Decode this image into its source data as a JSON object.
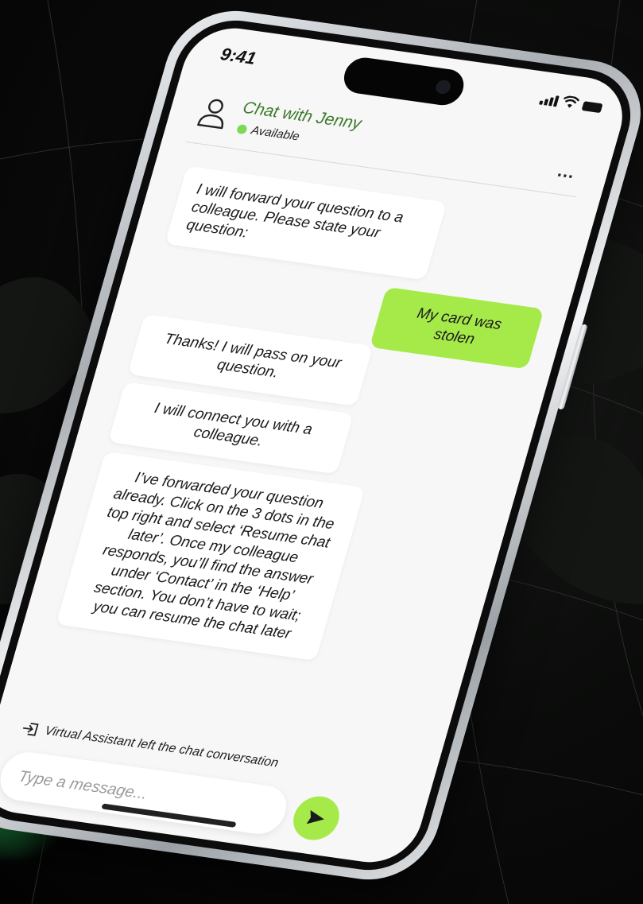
{
  "status_bar": {
    "time": "9:41"
  },
  "header": {
    "title": "Chat with Jenny",
    "status": "Available",
    "status_color": "#7ed957",
    "avatar_icon": "user-outline-icon",
    "more_label": "..."
  },
  "messages": [
    {
      "from": "bot",
      "text": "I will forward your question to a colleague. Please state your question:"
    },
    {
      "from": "user",
      "text": "My card was stolen"
    },
    {
      "from": "bot",
      "text": "Thanks! I will pass on your question."
    },
    {
      "from": "bot",
      "text": "I will connect you with a colleague."
    },
    {
      "from": "bot",
      "text": "I’ve forwarded your question already. Click on the 3 dots in the top right and select ‘Resume chat later’. Once my colleague responds, you’ll find the answer under ‘Contact’ in the ‘Help’ section. You don’t have to wait; you can resume the chat later"
    }
  ],
  "system_notice": {
    "icon": "exit-icon",
    "text": "Virtual Assistant left the chat conversation"
  },
  "composer": {
    "placeholder": "Type a message...",
    "send_icon": "send-icon"
  },
  "colors": {
    "accent": "#a6ea4a",
    "title_green": "#3c7a2a",
    "screen_bg": "#f7f7f7"
  }
}
